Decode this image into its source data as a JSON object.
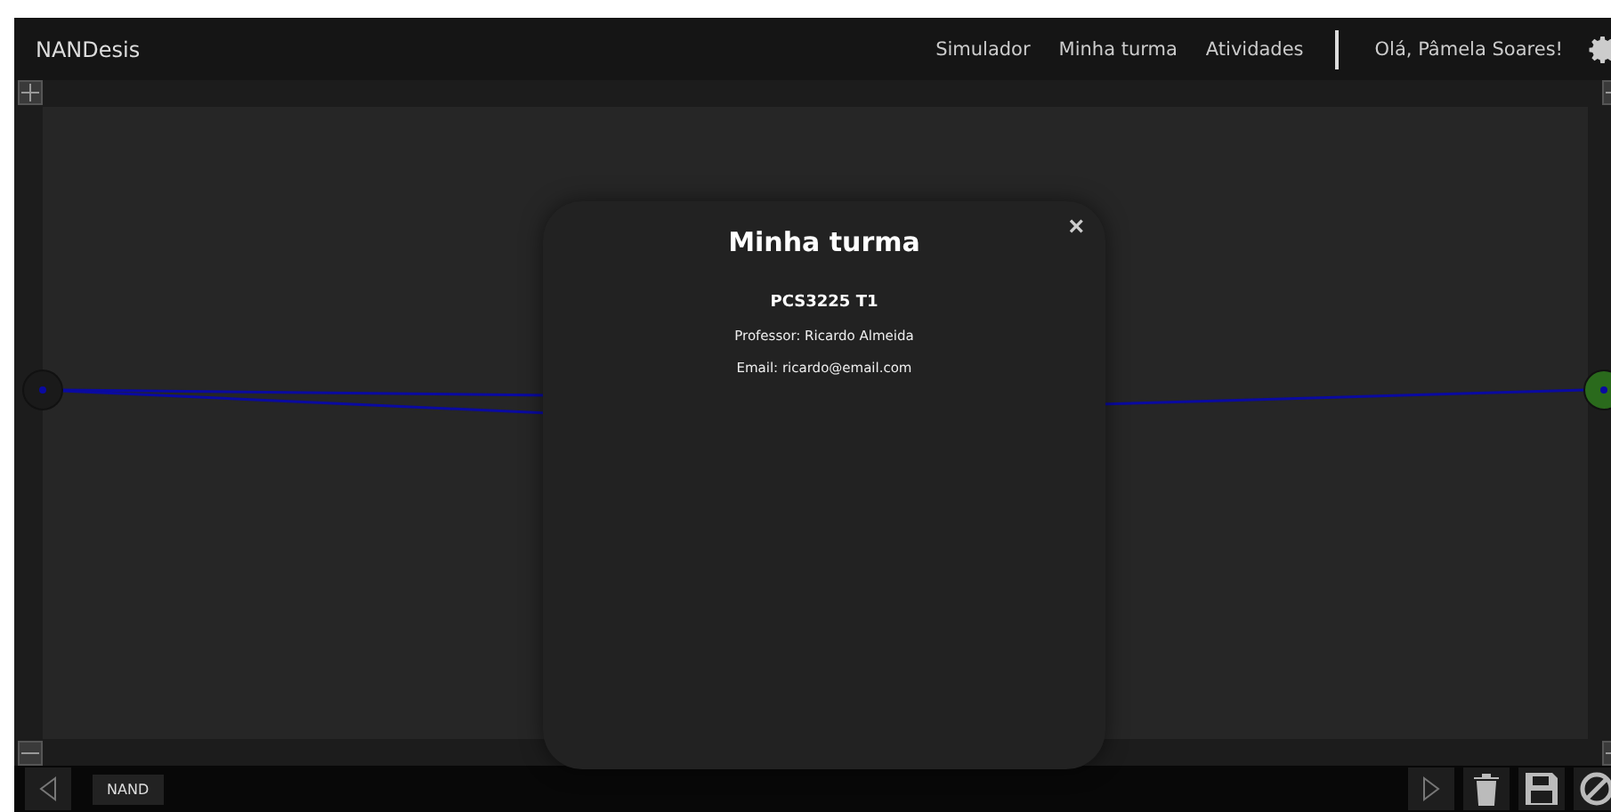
{
  "navbar": {
    "brand": "NANDesis",
    "links": [
      "Simulador",
      "Minha turma",
      "Atividades"
    ],
    "greeting": "Olá, Pâmela Soares!"
  },
  "canvas": {
    "nodes": [
      {
        "kind": "input",
        "on": false
      },
      {
        "kind": "output",
        "on": true
      }
    ]
  },
  "modal": {
    "close": "×",
    "title": "Minha turma",
    "class_name": "PCS3225 T1",
    "professor": "Professor: Ricardo Almeida",
    "email": "Email: ricardo@email.com"
  },
  "toolbar": {
    "components": [
      "NAND"
    ]
  }
}
